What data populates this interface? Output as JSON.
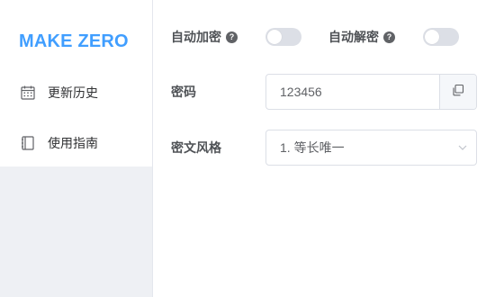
{
  "sidebar": {
    "logo": "MAKE ZERO",
    "items": [
      {
        "label": "更新历史",
        "icon": "calendar-icon"
      },
      {
        "label": "使用指南",
        "icon": "book-icon"
      }
    ]
  },
  "settings": {
    "auto_encrypt": {
      "label": "自动加密",
      "help": "?",
      "enabled": false
    },
    "auto_decrypt": {
      "label": "自动解密",
      "help": "?",
      "enabled": false
    },
    "password": {
      "label": "密码",
      "value": "123456",
      "append_icon": "copy-icon"
    },
    "cipher_style": {
      "label": "密文风格",
      "selected": "1. 等长唯一",
      "arrow_icon": "chevron-down-icon"
    }
  },
  "colors": {
    "brand": "#409eff",
    "sidebar_bg": "#eef0f4",
    "switch_off": "#dcdfe6",
    "border": "#dcdfe6"
  }
}
